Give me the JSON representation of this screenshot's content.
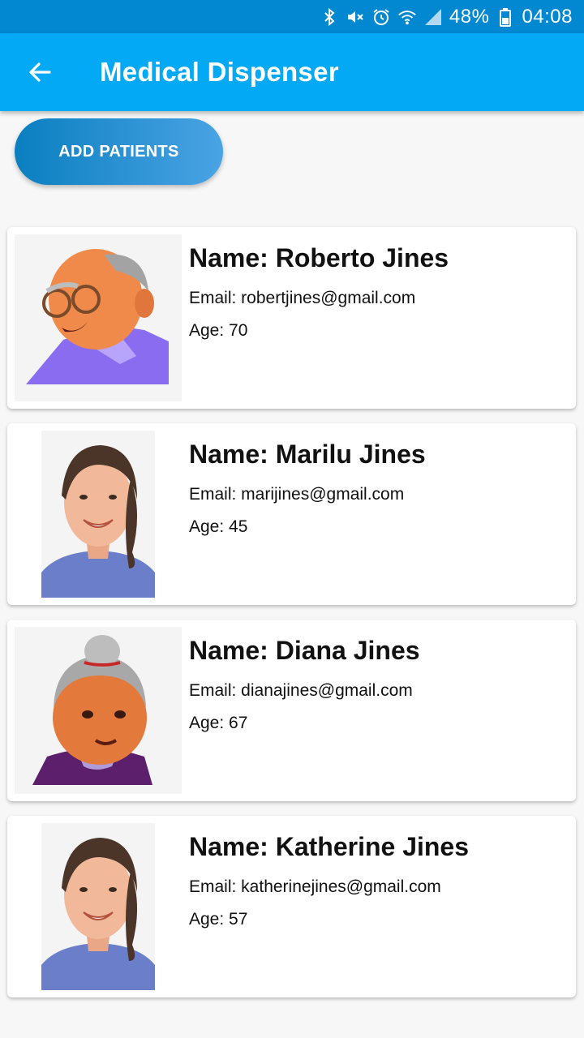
{
  "status_bar": {
    "battery": "48%",
    "time": "04:08",
    "icons": [
      "bluetooth-icon",
      "mute-icon",
      "alarm-icon",
      "wifi-icon",
      "signal-icon",
      "battery-icon"
    ]
  },
  "app_bar": {
    "title": "Medical Dispenser",
    "back_icon": "arrow-left-icon"
  },
  "add_button": {
    "label": "ADD PATIENTS"
  },
  "colors": {
    "status_bar": "#0288d1",
    "app_bar": "#03a9f4",
    "button_start": "#0a7fc0",
    "button_end": "#4aa3e4"
  },
  "patients": [
    {
      "name": "Name: Roberto Jines",
      "email": "Email: robertjines@gmail.com",
      "age": "Age: 70",
      "avatar": "old-man-avatar"
    },
    {
      "name": "Name: Marilu Jines",
      "email": "Email: marijines@gmail.com",
      "age": "Age: 45",
      "avatar": "woman-avatar"
    },
    {
      "name": "Name: Diana Jines",
      "email": "Email: dianajines@gmail.com",
      "age": "Age: 67",
      "avatar": "old-woman-avatar"
    },
    {
      "name": "Name: Katherine Jines",
      "email": "Email: katherinejines@gmail.com",
      "age": "Age: 57",
      "avatar": "woman-avatar"
    }
  ]
}
